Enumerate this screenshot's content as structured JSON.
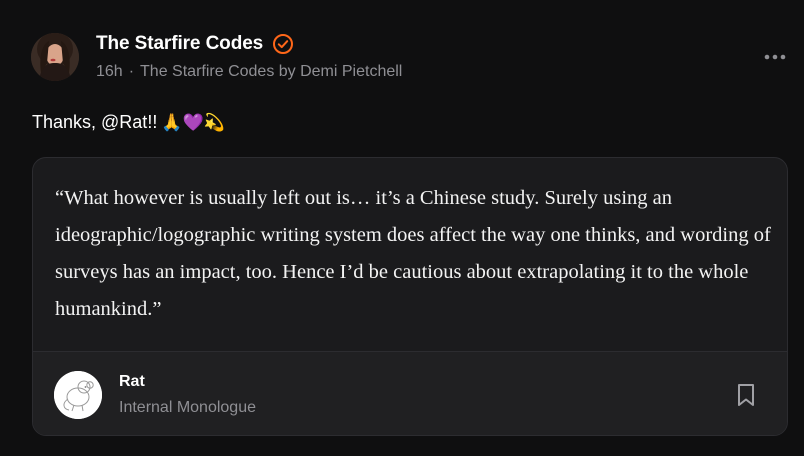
{
  "post": {
    "author_name": "The Starfire Codes",
    "time": "16h",
    "separator": "·",
    "publication": "The Starfire Codes by Demi Pietchell",
    "body_text": "Thanks, @Rat!!",
    "emojis": "🙏💜💫"
  },
  "quote": {
    "text": "“What however is usually left out is… it’s a Chinese study. Surely using an ideographic/logographic writing system does affect the way one thinks, and wording of surveys has an impact, too. Hence I’d be cautious about extrapolating it to the whole humankind.”",
    "author": "Rat",
    "publication": "Internal Monologue"
  },
  "colors": {
    "background": "#0f0f10",
    "verified_accent": "#ff6719",
    "muted_text": "#8f8f94",
    "card_bg": "#1b1b1d"
  },
  "icons": {
    "verified": "verified-badge-icon",
    "more": "more-options-icon",
    "bookmark": "bookmark-icon"
  }
}
